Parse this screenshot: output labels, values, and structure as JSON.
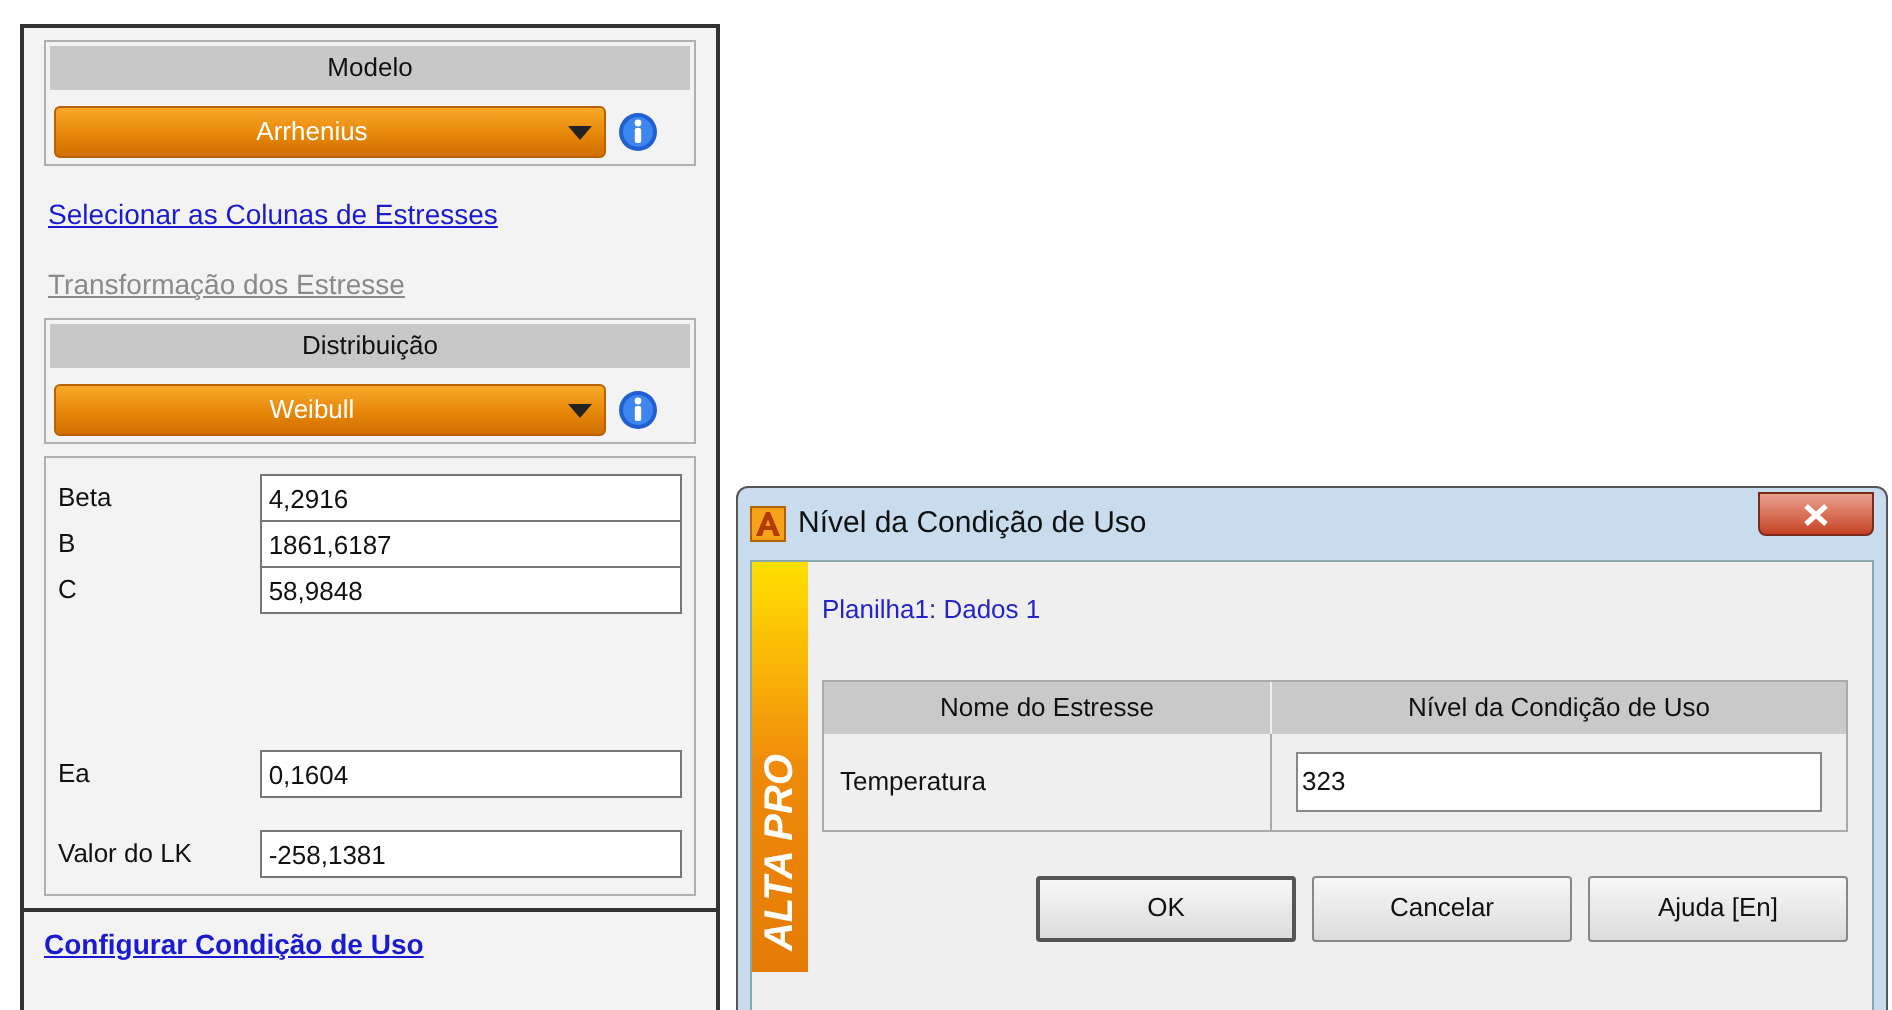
{
  "panel": {
    "model_section": {
      "title": "Modelo",
      "dropdown": "Arrhenius"
    },
    "links": [
      {
        "label": "Selecionar as Colunas de Estresses",
        "disabled": false
      },
      {
        "label": "Transformação dos Estresse",
        "disabled": true
      }
    ],
    "distribution_section": {
      "title": "Distribuição",
      "dropdown": "Weibull"
    },
    "parameters": [
      {
        "label": "Beta",
        "value": "4,2916"
      },
      {
        "label": "B",
        "value": "1861,6187"
      },
      {
        "label": "C",
        "value": "58,9848"
      }
    ],
    "results": [
      {
        "label": "Ea",
        "value": "0,1604"
      },
      {
        "label": "Valor do LK",
        "value": "-258,1381"
      }
    ],
    "footer_link": "Configurar Condição de Uso"
  },
  "dialog": {
    "title": "Nível da Condição de Uso",
    "brand_strip": "ALTA PRO",
    "sheet": "Planilha1: Dados 1",
    "table": {
      "columns": [
        "Nome do Estresse",
        "Nível da Condição de Uso"
      ],
      "rows": [
        {
          "name": "Temperatura",
          "value": "323"
        }
      ]
    },
    "buttons": [
      {
        "label": "OK",
        "default": true
      },
      {
        "label": "Cancelar",
        "default": false
      },
      {
        "label": "Ajuda [En]",
        "default": false
      }
    ]
  }
}
